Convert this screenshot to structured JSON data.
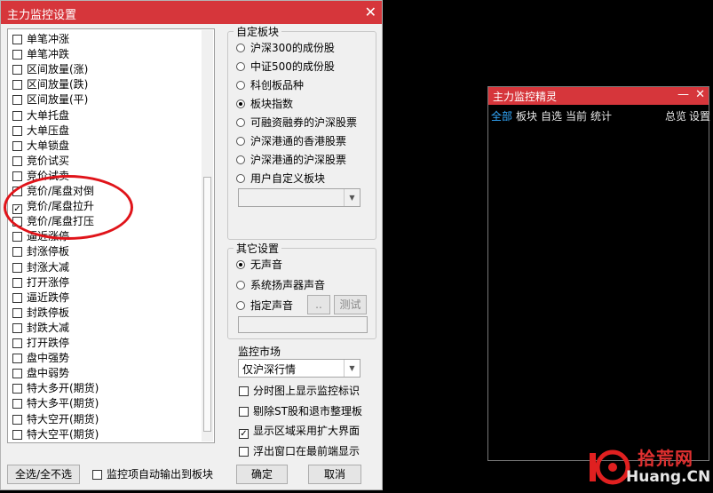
{
  "dialog": {
    "title": "主力监控设置",
    "close_glyph": "✕",
    "list_items": [
      {
        "label": "单笔冲涨",
        "checked": false
      },
      {
        "label": "单笔冲跌",
        "checked": false
      },
      {
        "label": "区间放量(涨)",
        "checked": false
      },
      {
        "label": "区间放量(跌)",
        "checked": false
      },
      {
        "label": "区间放量(平)",
        "checked": false
      },
      {
        "label": "大单托盘",
        "checked": false
      },
      {
        "label": "大单压盘",
        "checked": false
      },
      {
        "label": "大单锁盘",
        "checked": false
      },
      {
        "label": "竞价试买",
        "checked": false
      },
      {
        "label": "竞价试卖",
        "checked": false
      },
      {
        "label": "竞价/尾盘对倒",
        "checked": false
      },
      {
        "label": "竞价/尾盘拉升",
        "checked": true
      },
      {
        "label": "竞价/尾盘打压",
        "checked": false
      },
      {
        "label": "逼近涨停",
        "checked": false
      },
      {
        "label": "封涨停板",
        "checked": false
      },
      {
        "label": "封涨大减",
        "checked": false
      },
      {
        "label": "打开涨停",
        "checked": false
      },
      {
        "label": "逼近跌停",
        "checked": false
      },
      {
        "label": "封跌停板",
        "checked": false
      },
      {
        "label": "封跌大减",
        "checked": false
      },
      {
        "label": "打开跌停",
        "checked": false
      },
      {
        "label": "盘中强势",
        "checked": false
      },
      {
        "label": "盘中弱势",
        "checked": false
      },
      {
        "label": "特大多开(期货)",
        "checked": false
      },
      {
        "label": "特大多平(期货)",
        "checked": false
      },
      {
        "label": "特大空开(期货)",
        "checked": false
      },
      {
        "label": "特大空平(期货)",
        "checked": false
      }
    ],
    "custom_block": {
      "legend": "自定板块",
      "options": [
        "沪深300的成份股",
        "中证500的成份股",
        "科创板品种",
        "板块指数",
        "可融资融券的沪深股票",
        "沪深港通的香港股票",
        "沪深港通的沪深股票",
        "用户自定义板块"
      ],
      "selected_index": 3,
      "combo_value": ""
    },
    "other_settings": {
      "legend": "其它设置",
      "options": [
        "无声音",
        "系统扬声器声音",
        "指定声音"
      ],
      "selected_index": 0,
      "browse_label": "..",
      "test_label": "测试",
      "sound_path": ""
    },
    "market": {
      "label": "监控市场",
      "value": "仅沪深行情"
    },
    "checks": [
      {
        "label": "分时图上显示监控标识",
        "checked": false
      },
      {
        "label": "剔除ST股和退市整理板",
        "checked": false
      },
      {
        "label": "显示区域采用扩大界面",
        "checked": true
      },
      {
        "label": "浮出窗口在最前端显示",
        "checked": false
      }
    ],
    "select_all_label": "全选/全不选",
    "auto_output_label": "监控项自动输出到板块",
    "auto_output_checked": false,
    "ok_label": "确定",
    "cancel_label": "取消"
  },
  "sprite": {
    "title": "主力监控精灵",
    "min_glyph": "—",
    "close_glyph": "✕",
    "menu_left": [
      "全部",
      "板块",
      "自选",
      "当前",
      "统计"
    ],
    "menu_right": [
      "总览",
      "设置"
    ],
    "active_menu": "全部"
  },
  "watermark": {
    "logo_text": "10",
    "site_cn": "拾荒网",
    "site_en": "Huang.CN"
  },
  "colors": {
    "titlebar": "#d6363b",
    "annotation": "#e0141a",
    "active_menu": "#33aaff"
  }
}
